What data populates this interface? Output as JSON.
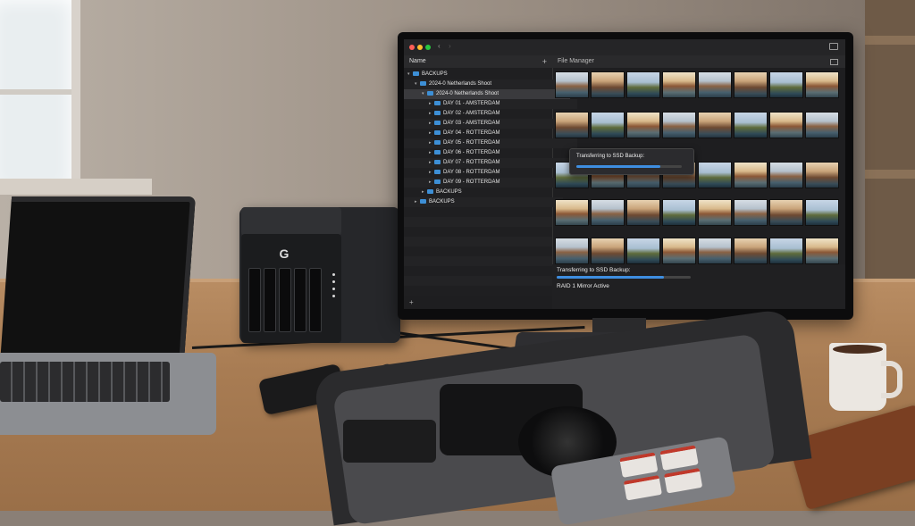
{
  "scene": "desk-setup",
  "device": {
    "logo_letter": "G"
  },
  "app": {
    "window_title": "File Manager",
    "sidebar_header": "Name",
    "tree": [
      {
        "label": "BACKUPS",
        "level": 0,
        "expanded": true
      },
      {
        "label": "2024-0 Netherlands Shoot",
        "level": 1,
        "expanded": true
      },
      {
        "label": "2024-0 Netherlands Shoot",
        "level": 2,
        "expanded": true,
        "selected": true
      },
      {
        "label": "DAY 01 - AMSTERDAM",
        "level": 3
      },
      {
        "label": "DAY 02 - AMSTERDAM",
        "level": 3
      },
      {
        "label": "DAY 03 - AMSTERDAM",
        "level": 3
      },
      {
        "label": "DAY 04 - ROTTERDAM",
        "level": 3
      },
      {
        "label": "DAY 05 - ROTTERDAM",
        "level": 3
      },
      {
        "label": "DAY 06 - ROTTERDAM",
        "level": 3
      },
      {
        "label": "DAY 07 - ROTTERDAM",
        "level": 3
      },
      {
        "label": "DAY 08 - ROTTERDAM",
        "level": 3
      },
      {
        "label": "DAY 09 - ROTTERDAM",
        "level": 3
      },
      {
        "label": "BACKUPS",
        "level": 2
      },
      {
        "label": "BACKUPS",
        "level": 1
      }
    ],
    "popup": {
      "text": "Transferring to SSD Backup:",
      "progress": 0.8
    },
    "status": {
      "transfer_text": "Transferring to SSD Backup:",
      "transfer_progress": 0.8,
      "raid_text": "RAID 1 Mirror Active"
    },
    "colors": {
      "accent": "#3e8ee0",
      "folder": "#3d8fd6",
      "close": "#ff5f57",
      "minimize": "#febc2e",
      "zoom": "#28c840"
    }
  }
}
